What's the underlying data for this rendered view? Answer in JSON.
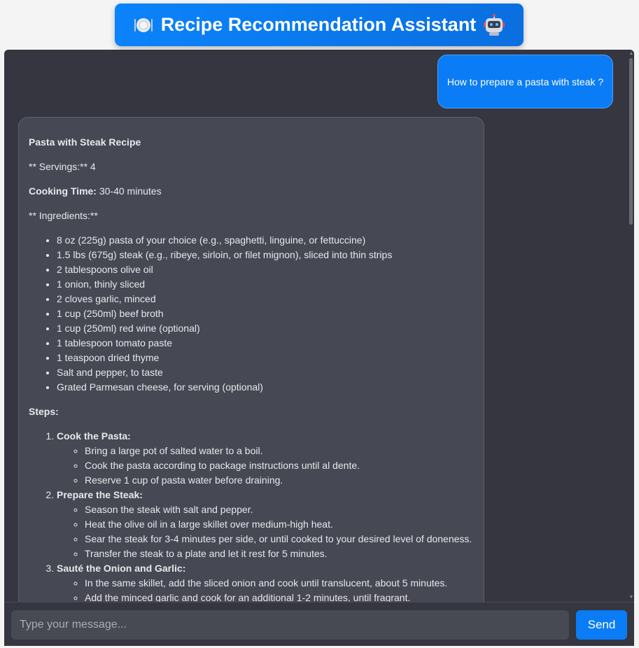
{
  "header": {
    "title": "Recipe Recommendation Assistant",
    "left_icon": "plate-cutlery-icon",
    "right_icon": "robot-icon"
  },
  "conversation": {
    "user_message": "How to prepare a pasta with steak ?",
    "bot": {
      "recipe_title": "Pasta with Steak Recipe",
      "servings_label": "** Servings:**",
      "servings_value": " 4",
      "cooking_time_label": "Cooking Time:",
      "cooking_time_value": " 30-40 minutes",
      "ingredients_label": "** Ingredients:**",
      "ingredients": [
        "8 oz (225g) pasta of your choice (e.g., spaghetti, linguine, or fettuccine)",
        "1.5 lbs (675g) steak (e.g., ribeye, sirloin, or filet mignon), sliced into thin strips",
        "2 tablespoons olive oil",
        "1 onion, thinly sliced",
        "2 cloves garlic, minced",
        "1 cup (250ml) beef broth",
        "1 cup (250ml) red wine (optional)",
        "1 tablespoon tomato paste",
        "1 teaspoon dried thyme",
        "Salt and pepper, to taste",
        "Grated Parmesan cheese, for serving (optional)"
      ],
      "steps_label": "Steps:",
      "steps": [
        {
          "title": "Cook the Pasta:",
          "items": [
            "Bring a large pot of salted water to a boil.",
            "Cook the pasta according to package instructions until al dente.",
            "Reserve 1 cup of pasta water before draining."
          ]
        },
        {
          "title": "Prepare the Steak:",
          "items": [
            "Season the steak with salt and pepper.",
            "Heat the olive oil in a large skillet over medium-high heat.",
            "Sear the steak for 3-4 minutes per side, or until cooked to your desired level of doneness.",
            "Transfer the steak to a plate and let it rest for 5 minutes."
          ]
        },
        {
          "title": "Sauté the Onion and Garlic:",
          "items": [
            "In the same skillet, add the sliced onion and cook until translucent, about 5 minutes.",
            "Add the minced garlic and cook for an additional 1-2 minutes, until fragrant."
          ]
        }
      ]
    }
  },
  "input": {
    "placeholder": "Type your message...",
    "value": "",
    "send_label": "Send"
  },
  "colors": {
    "accent": "#0a7cf5",
    "chat_bg": "#363640",
    "bot_bubble": "#464853"
  }
}
